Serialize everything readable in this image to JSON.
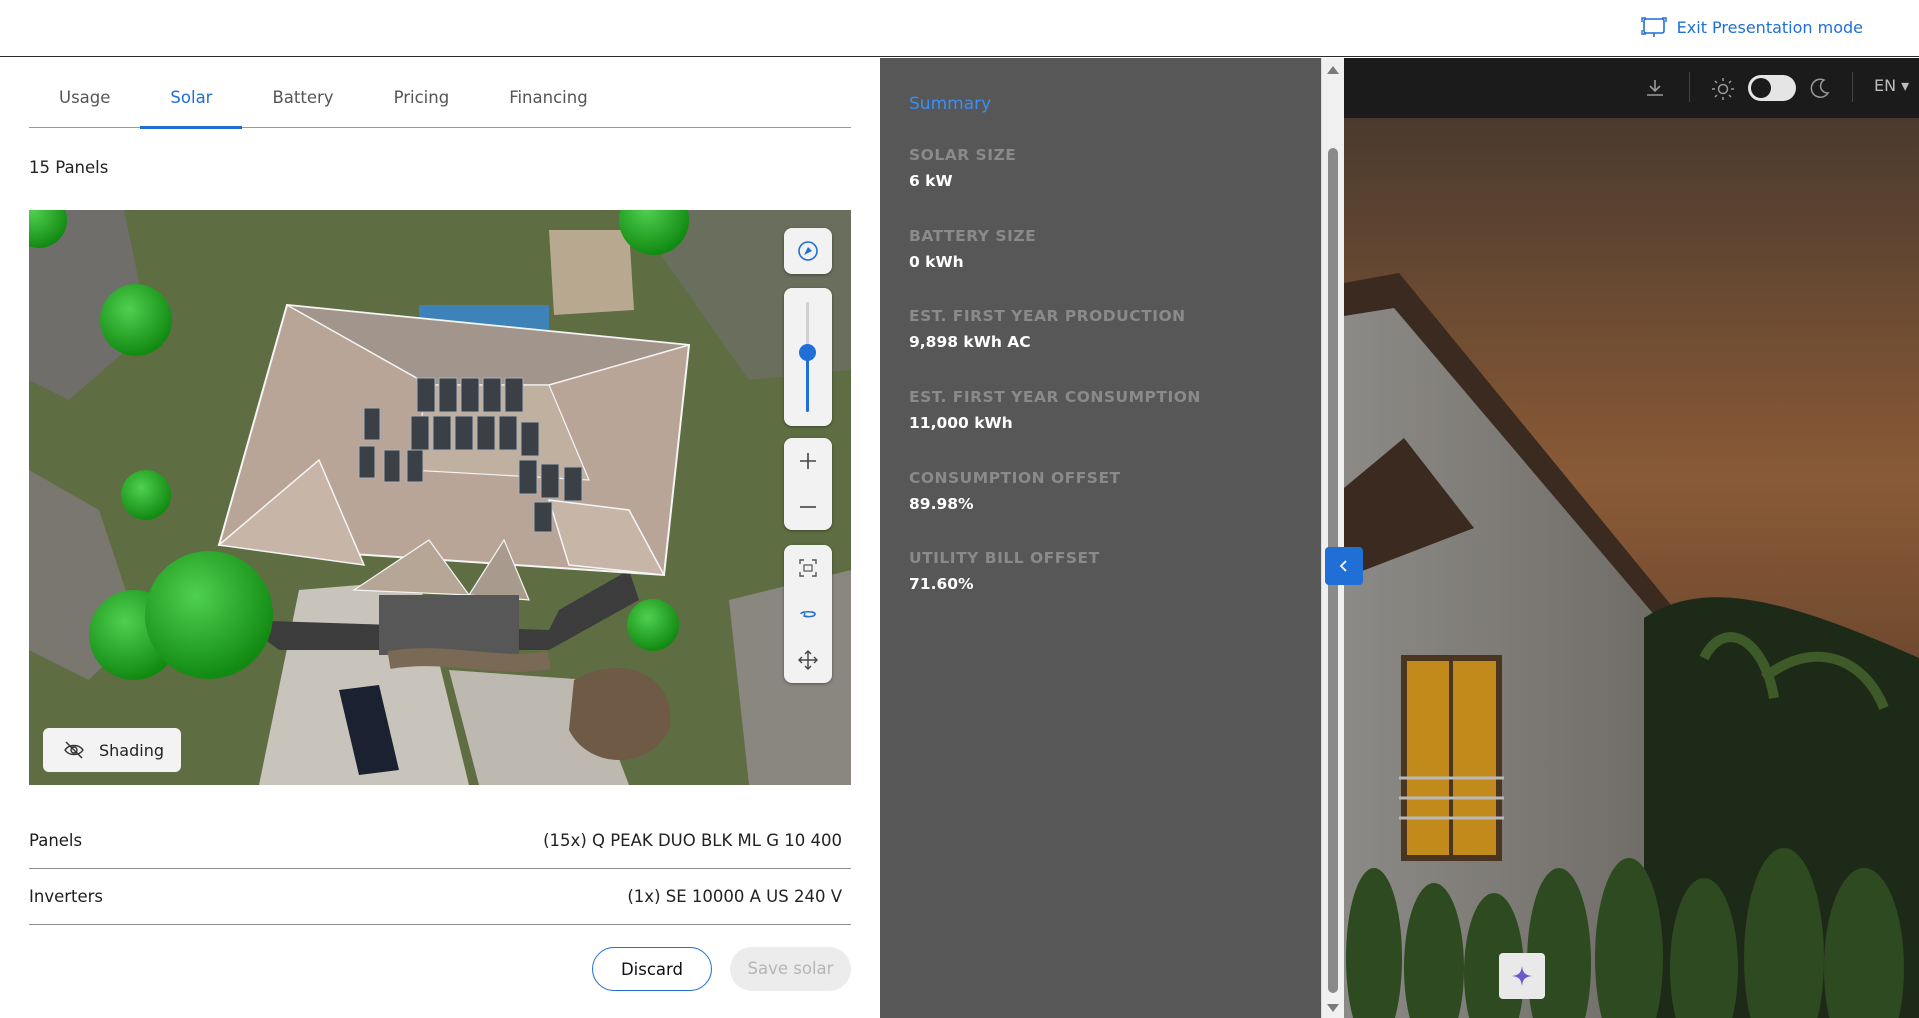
{
  "header": {
    "exit_label": "Exit Presentation mode"
  },
  "tabs": [
    {
      "label": "Usage"
    },
    {
      "label": "Solar"
    },
    {
      "label": "Battery"
    },
    {
      "label": "Pricing"
    },
    {
      "label": "Financing"
    }
  ],
  "solar": {
    "panel_count": "15 Panels",
    "shading_label": "Shading",
    "zoom_level": 0.45,
    "specs": [
      {
        "label": "Panels",
        "value": "(15x) Q PEAK DUO BLK ML G 10 400"
      },
      {
        "label": "Inverters",
        "value": "(1x) SE 10000 A US 240 V"
      }
    ],
    "discard_label": "Discard",
    "save_label": "Save solar"
  },
  "summary": {
    "title": "Summary",
    "stats": [
      {
        "label": "SOLAR SIZE",
        "value": "6 kW"
      },
      {
        "label": "BATTERY SIZE",
        "value": "0 kWh"
      },
      {
        "label": "EST. FIRST YEAR PRODUCTION",
        "value": "9,898 kWh AC"
      },
      {
        "label": "EST. FIRST YEAR CONSUMPTION",
        "value": "11,000 kWh"
      },
      {
        "label": "CONSUMPTION OFFSET",
        "value": "89.98%"
      },
      {
        "label": "UTILITY BILL OFFSET",
        "value": "71.60%"
      }
    ]
  },
  "photo_bar": {
    "language": "EN"
  },
  "colors": {
    "accent": "#1f6fd6",
    "summary_bg": "#575757",
    "tree_green": "#1fa31f"
  }
}
